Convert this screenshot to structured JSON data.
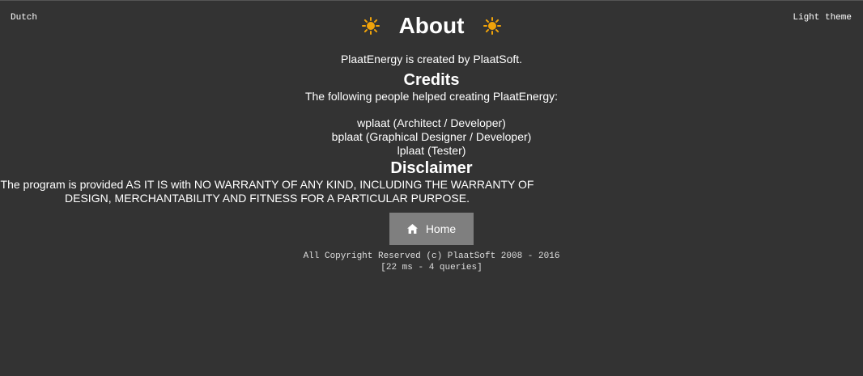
{
  "header": {
    "language_link": "Dutch",
    "theme_link": "Light theme",
    "title": "About",
    "title_icon": "sun-icon",
    "accent_color": "#f0a30a"
  },
  "about": {
    "intro": "PlaatEnergy is created by PlaatSoft."
  },
  "credits": {
    "heading": "Credits",
    "text": "The following people helped creating PlaatEnergy:",
    "people": [
      "wplaat (Architect / Developer)",
      "bplaat (Graphical Designer / Developer)",
      "lplaat (Tester)"
    ]
  },
  "disclaimer": {
    "heading": "Disclaimer",
    "text": "The program is provided AS IT IS with NO WARRANTY OF ANY KIND, INCLUDING THE WARRANTY OF DESIGN, MERCHANTABILITY AND FITNESS FOR A PARTICULAR PURPOSE."
  },
  "home_button": {
    "label": "Home",
    "icon": "home-icon"
  },
  "footer": {
    "copyright": "All Copyright Reserved (c) PlaatSoft 2008 - 2016",
    "stats": "[22 ms - 4 queries]"
  }
}
